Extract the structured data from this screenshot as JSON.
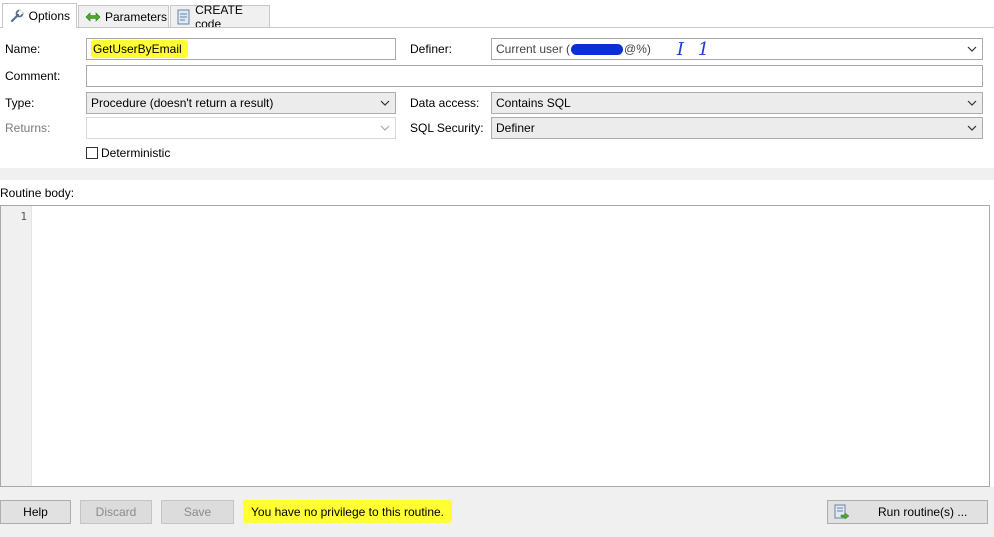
{
  "tabs": [
    {
      "label": "Options",
      "icon": "wrench-icon",
      "active": true
    },
    {
      "label": "Parameters",
      "icon": "arrows-icon",
      "active": false
    },
    {
      "label": "CREATE code",
      "icon": "document-code-icon",
      "active": false
    }
  ],
  "options": {
    "name_label": "Name:",
    "name_value": "GetUserByEmail",
    "definer_label": "Definer:",
    "definer_value_prefix": "Current user (",
    "definer_value_suffix": "@%)",
    "definer_annotation": "I 1",
    "comment_label": "Comment:",
    "comment_value": "",
    "type_label": "Type:",
    "type_value": "Procedure (doesn't return a result)",
    "data_access_label": "Data access:",
    "data_access_value": "Contains SQL",
    "returns_label": "Returns:",
    "returns_value": "",
    "sql_security_label": "SQL Security:",
    "sql_security_value": "Definer",
    "deterministic_label": "Deterministic",
    "deterministic_checked": false
  },
  "routine_body": {
    "label": "Routine body:",
    "line_numbers": [
      "1"
    ],
    "code": ""
  },
  "buttons": {
    "help": "Help",
    "discard": "Discard",
    "save": "Save",
    "run": "Run routine(s) ..."
  },
  "status_message": "You have no privilege to this routine.",
  "colors": {
    "highlight": "#ffff33",
    "annotation_ink": "#1a3fd0",
    "redaction_ink": "#0a2fd6",
    "panel_bg": "#f0f0f0"
  }
}
